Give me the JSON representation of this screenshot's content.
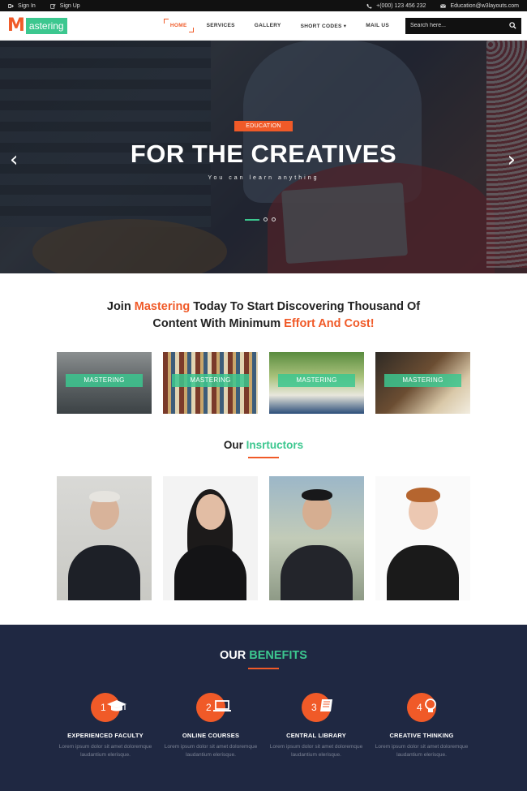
{
  "topbar": {
    "sign_in": "Sign In",
    "sign_up": "Sign Up",
    "phone": "+(000) 123 456 232",
    "email": "Education@w3layouts.com"
  },
  "header": {
    "logo_letter": "M",
    "logo_word": "astering",
    "nav": [
      "HOME",
      "SERVICES",
      "GALLERY",
      "SHORT CODES ▾",
      "MAIL US"
    ],
    "search_placeholder": "Search here..."
  },
  "hero": {
    "badge": "EDUCATION",
    "title": "FOR THE CREATIVES",
    "subtitle": "You can learn anything"
  },
  "join": {
    "line1_a": "Join ",
    "line1_b": "Mastering",
    "line1_c": " Today To Start Discovering Thousand Of",
    "line2_a": "Content With Minimum ",
    "line2_b": "Effort And Cost!"
  },
  "courses": [
    "MASTERING",
    "MASTERING",
    "MASTERING",
    "MASTERING"
  ],
  "instructors": {
    "title_a": "Our ",
    "title_b": "Insrtuctors"
  },
  "benefits": {
    "title_a": "OUR ",
    "title_b": "BENEFITS",
    "items": [
      {
        "num": "1",
        "icon": "graduation-cap-icon",
        "title": "EXPERIENCED FACULTY",
        "text": "Lorem ipsum dolor sit amet doloremque laudantium elerisque."
      },
      {
        "num": "2",
        "icon": "laptop-icon",
        "title": "ONLINE COURSES",
        "text": "Lorem ipsum dolor sit amet doloremque laudantium elerisque."
      },
      {
        "num": "3",
        "icon": "book-icon",
        "title": "CENTRAL LIBRARY",
        "text": "Lorem ipsum dolor sit amet doloremque laudantium elerisque."
      },
      {
        "num": "4",
        "icon": "lightbulb-icon",
        "title": "CREATIVE THINKING",
        "text": "Lorem ipsum dolor sit amet doloremque laudantium elerisque."
      }
    ]
  },
  "colors": {
    "accent": "#f05a28",
    "brand": "#3cc78f",
    "dark": "#1f2842"
  }
}
